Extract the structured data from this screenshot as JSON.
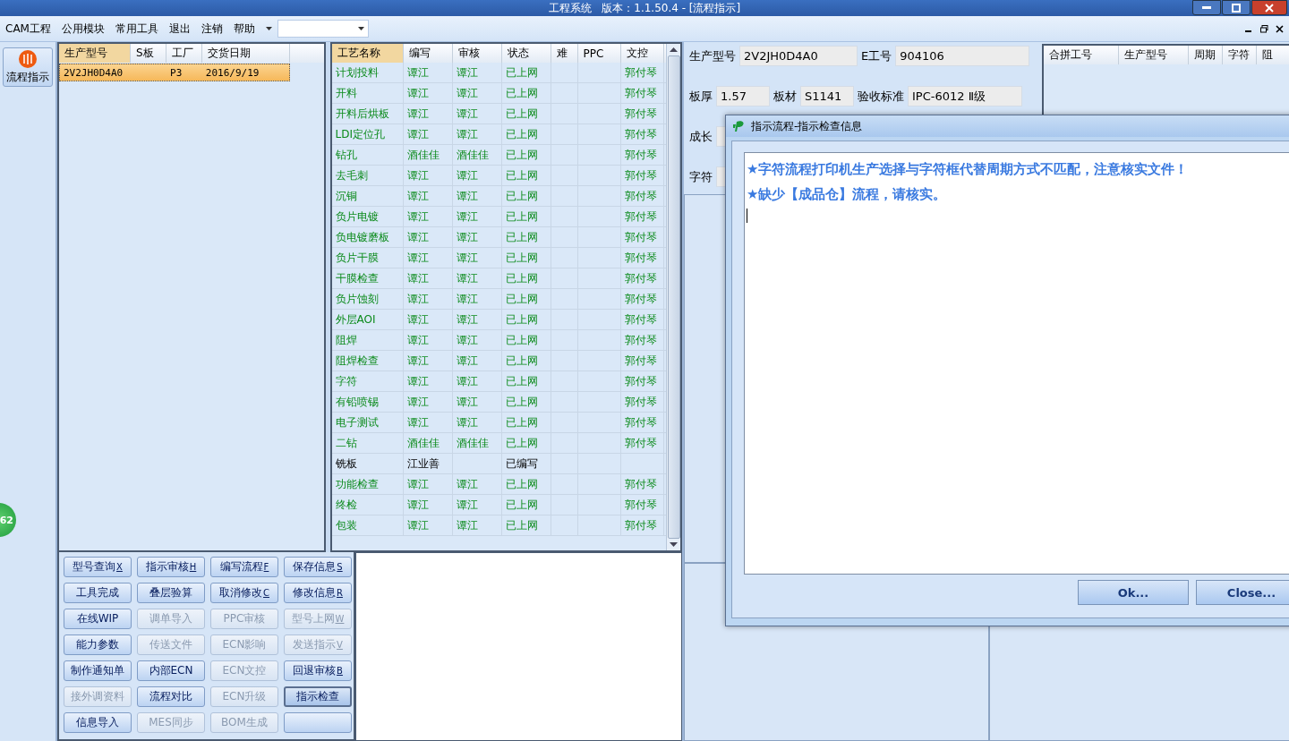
{
  "window": {
    "title": "工程系统   版本：1.1.50.4 - [流程指示]"
  },
  "menu": {
    "items": [
      "CAM工程",
      "公用模块",
      "常用工具",
      "退出",
      "注销",
      "帮助"
    ]
  },
  "sidebar": {
    "buttons": [
      {
        "label": "流程指示",
        "selected": true
      }
    ],
    "badge": "62"
  },
  "order_table": {
    "columns": [
      "生产型号",
      "S板",
      "工厂",
      "交货日期"
    ],
    "rows": [
      {
        "cells": [
          "2V2JH0D4A0",
          "",
          "P3",
          "2016/9/19"
        ],
        "selected": true
      }
    ]
  },
  "process_table": {
    "columns": [
      "工艺名称",
      "编写",
      "审核",
      "状态",
      "难",
      "PPC",
      "文控"
    ],
    "rows": [
      {
        "kind": "online",
        "cells": [
          "计划投料",
          "谭江",
          "谭江",
          "已上网",
          "",
          "",
          "郭付琴"
        ]
      },
      {
        "kind": "online",
        "cells": [
          "开料",
          "谭江",
          "谭江",
          "已上网",
          "",
          "",
          "郭付琴"
        ]
      },
      {
        "kind": "online",
        "cells": [
          "开料后烘板",
          "谭江",
          "谭江",
          "已上网",
          "",
          "",
          "郭付琴"
        ]
      },
      {
        "kind": "online",
        "cells": [
          "LDI定位孔",
          "谭江",
          "谭江",
          "已上网",
          "",
          "",
          "郭付琴"
        ]
      },
      {
        "kind": "online",
        "cells": [
          "钻孔",
          "酒佳佳",
          "酒佳佳",
          "已上网",
          "",
          "",
          "郭付琴"
        ]
      },
      {
        "kind": "online",
        "cells": [
          "去毛刺",
          "谭江",
          "谭江",
          "已上网",
          "",
          "",
          "郭付琴"
        ]
      },
      {
        "kind": "online",
        "cells": [
          "沉铜",
          "谭江",
          "谭江",
          "已上网",
          "",
          "",
          "郭付琴"
        ]
      },
      {
        "kind": "online",
        "cells": [
          "负片电镀",
          "谭江",
          "谭江",
          "已上网",
          "",
          "",
          "郭付琴"
        ]
      },
      {
        "kind": "online",
        "cells": [
          "负电镀磨板",
          "谭江",
          "谭江",
          "已上网",
          "",
          "",
          "郭付琴"
        ]
      },
      {
        "kind": "online",
        "cells": [
          "负片干膜",
          "谭江",
          "谭江",
          "已上网",
          "",
          "",
          "郭付琴"
        ]
      },
      {
        "kind": "online",
        "cells": [
          "干膜检查",
          "谭江",
          "谭江",
          "已上网",
          "",
          "",
          "郭付琴"
        ]
      },
      {
        "kind": "online",
        "cells": [
          "负片蚀刻",
          "谭江",
          "谭江",
          "已上网",
          "",
          "",
          "郭付琴"
        ]
      },
      {
        "kind": "online",
        "cells": [
          "外层AOI",
          "谭江",
          "谭江",
          "已上网",
          "",
          "",
          "郭付琴"
        ]
      },
      {
        "kind": "online",
        "cells": [
          "阻焊",
          "谭江",
          "谭江",
          "已上网",
          "",
          "",
          "郭付琴"
        ]
      },
      {
        "kind": "online",
        "cells": [
          "阻焊检查",
          "谭江",
          "谭江",
          "已上网",
          "",
          "",
          "郭付琴"
        ]
      },
      {
        "kind": "online",
        "cells": [
          "字符",
          "谭江",
          "谭江",
          "已上网",
          "",
          "",
          "郭付琴"
        ]
      },
      {
        "kind": "online",
        "cells": [
          "有铅喷锡",
          "谭江",
          "谭江",
          "已上网",
          "",
          "",
          "郭付琴"
        ]
      },
      {
        "kind": "online",
        "cells": [
          "电子测试",
          "谭江",
          "谭江",
          "已上网",
          "",
          "",
          "郭付琴"
        ]
      },
      {
        "kind": "online",
        "cells": [
          "二钻",
          "酒佳佳",
          "酒佳佳",
          "已上网",
          "",
          "",
          "郭付琴"
        ]
      },
      {
        "kind": "draft",
        "cells": [
          "铣板",
          "江业善",
          "",
          "已编写",
          "",
          "",
          ""
        ]
      },
      {
        "kind": "online",
        "cells": [
          "功能检查",
          "谭江",
          "谭江",
          "已上网",
          "",
          "",
          "郭付琴"
        ]
      },
      {
        "kind": "online",
        "cells": [
          "终检",
          "谭江",
          "谭江",
          "已上网",
          "",
          "",
          "郭付琴"
        ]
      },
      {
        "kind": "online",
        "cells": [
          "包装",
          "谭江",
          "谭江",
          "已上网",
          "",
          "",
          "郭付琴"
        ]
      }
    ]
  },
  "action_buttons": [
    {
      "label": "型号查询",
      "key": "X",
      "disabled": false,
      "selected": false
    },
    {
      "label": "指示审核",
      "key": "H",
      "disabled": false,
      "selected": false
    },
    {
      "label": "编写流程",
      "key": "F",
      "disabled": false,
      "selected": false
    },
    {
      "label": "保存信息",
      "key": "S",
      "disabled": false,
      "selected": false
    },
    {
      "label": "工具完成",
      "disabled": false,
      "selected": false
    },
    {
      "label": "叠层验算",
      "disabled": false,
      "selected": false
    },
    {
      "label": "取消修改",
      "key": "C",
      "disabled": false,
      "selected": false
    },
    {
      "label": "修改信息",
      "key": "R",
      "disabled": false,
      "selected": false
    },
    {
      "label": "在线WIP",
      "disabled": false,
      "selected": false
    },
    {
      "label": "调单导入",
      "disabled": true,
      "selected": false
    },
    {
      "label": "PPC审核",
      "disabled": true,
      "selected": false
    },
    {
      "label": "型号上网",
      "key": "W",
      "disabled": true,
      "selected": false
    },
    {
      "label": "能力参数",
      "disabled": false,
      "selected": false
    },
    {
      "label": "传送文件",
      "disabled": true,
      "selected": false
    },
    {
      "label": "ECN影响",
      "disabled": true,
      "selected": false
    },
    {
      "label": "发送指示",
      "key": "V",
      "disabled": true,
      "selected": false
    },
    {
      "label": "制作通知单",
      "disabled": false,
      "selected": false
    },
    {
      "label": "内部ECN",
      "disabled": false,
      "selected": false
    },
    {
      "label": "ECN文控",
      "disabled": true,
      "selected": false
    },
    {
      "label": "回退审核",
      "key": "B",
      "disabled": false,
      "selected": false
    },
    {
      "label": "接外调资料",
      "disabled": true,
      "selected": false
    },
    {
      "label": "流程对比",
      "disabled": false,
      "selected": false
    },
    {
      "label": "ECN升级",
      "disabled": true,
      "selected": false
    },
    {
      "label": "指示检查",
      "disabled": false,
      "selected": true
    },
    {
      "label": "信息导入",
      "disabled": false,
      "selected": false
    },
    {
      "label": "MES同步",
      "disabled": true,
      "selected": false
    },
    {
      "label": "BOM生成",
      "disabled": true,
      "selected": false
    },
    {
      "disabled": false,
      "selected": false
    }
  ],
  "info_form": {
    "fields": [
      {
        "label": "生产型号",
        "value": "2V2JH0D4A0"
      },
      {
        "label": "E工号",
        "value": "904106"
      },
      {
        "label": "板厚",
        "value": "1.57"
      },
      {
        "label": "板材",
        "value": "S1141"
      },
      {
        "label": "验收标准",
        "value": "IPC-6012 Ⅱ级"
      },
      {
        "label": "成长"
      },
      {
        "label": "字符"
      }
    ]
  },
  "merge_table": {
    "columns": [
      "合拼工号",
      "生产型号",
      "周期",
      "字符",
      "阻"
    ]
  },
  "dialog": {
    "title": "指示流程-指示检查信息",
    "messages": [
      "★字符流程打印机生产选择与字符框代替周期方式不匹配，注意核实文件！",
      "★缺少【成品仓】流程，请核实。"
    ],
    "buttons": [
      "Ok...",
      "Close..."
    ]
  }
}
